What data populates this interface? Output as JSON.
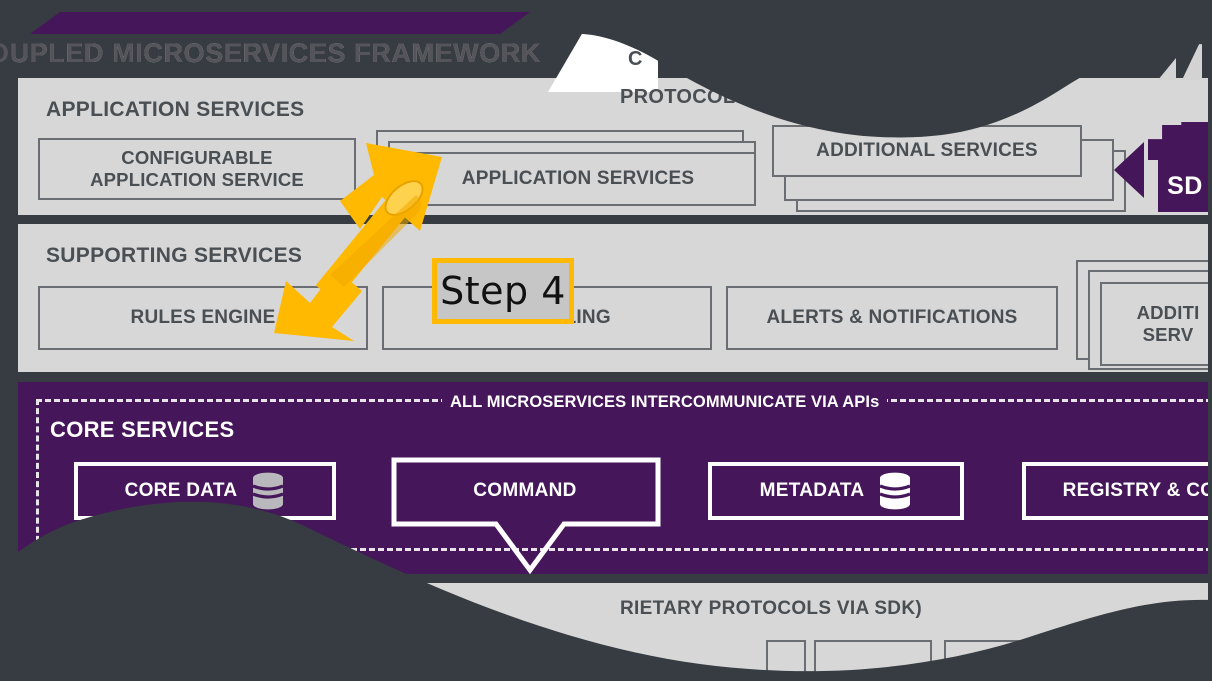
{
  "header": {
    "title": "OUPLED MICROSERVICES FRAMEWORK",
    "purple_band": "",
    "accent_purple": "#46165a",
    "overlay_dark": "#363c41",
    "panel_gray": "#d7d7d7"
  },
  "application_services": {
    "panel_title": "APPLICATION SERVICES",
    "configurable": "CONFIGURABLE\nAPPLICATION SERVICE",
    "configurable_line1": "CONFIGURABLE",
    "configurable_line2": "APPLICATION SERVICE",
    "app_services": "APPLICATION SERVICES",
    "additional_services": "ADDITIONAL SERVICES",
    "protocol_line1": "C",
    "protocol_line2": "PROTOCOL"
  },
  "supporting_services": {
    "panel_title": "SUPPORTING SERVICES",
    "boxes": [
      "RULES ENGINE",
      "SCHEDULING",
      "ALERTS & NOTIFICATIONS"
    ],
    "additional_line1": "ADDITI",
    "additional_line2": "SERV"
  },
  "core_services": {
    "panel_title": "CORE SERVICES",
    "api_label": "ALL MICROSERVICES INTERCOMMUNICATE VIA APIs",
    "boxes": [
      {
        "label": "CORE DATA",
        "has_db_icon": true
      },
      {
        "label": "COMMAND",
        "has_db_icon": false
      },
      {
        "label": "METADATA",
        "has_db_icon": true
      },
      {
        "label": "REGISTRY & CO",
        "has_db_icon": false
      }
    ]
  },
  "device_services": {
    "caption": "RIETARY PROTOCOLS VIA SDK)"
  },
  "sdk": {
    "label": "SD",
    "icon": "sdk-tag-icon",
    "pointer": "left-triangle-icon"
  },
  "callout": {
    "label": "Step 4",
    "border_color": "#ffb900",
    "fill_color": "#c6c6c6"
  },
  "arrow": {
    "name": "double-headed-arrow",
    "color": "#ffb900",
    "highlight": "#ffd24d",
    "shadow": "#e8a200"
  }
}
